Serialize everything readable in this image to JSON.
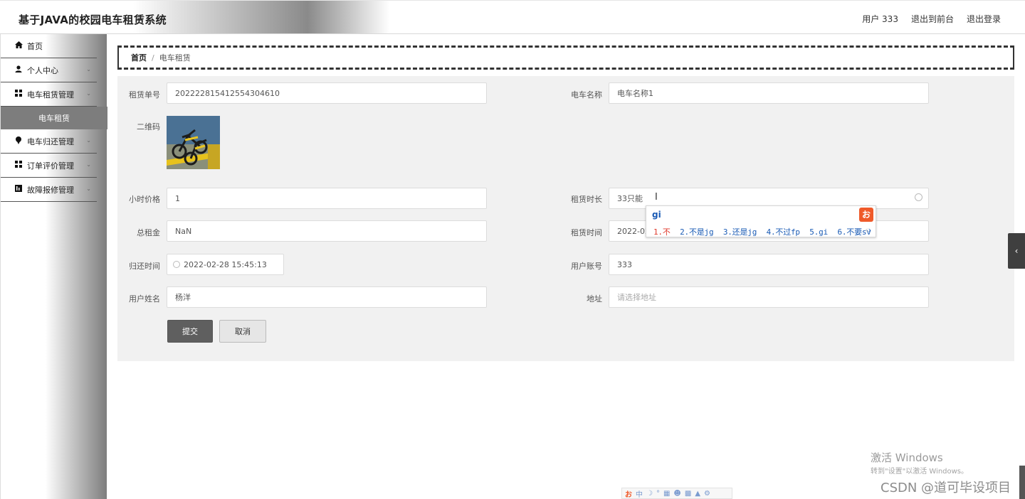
{
  "header": {
    "title": "基于JAVA的校园电车租赁系统",
    "user_label": "用户 333",
    "to_front_label": "退出到前台",
    "logout_label": "退出登录"
  },
  "sidebar": {
    "items": [
      {
        "label": "首页",
        "icon": "home-icon"
      },
      {
        "label": "个人中心",
        "icon": "user-icon"
      },
      {
        "label": "电车租赁管理",
        "icon": "grid-icon"
      },
      {
        "label": "电车租赁",
        "icon": ""
      },
      {
        "label": "电车归还管理",
        "icon": "pin-icon"
      },
      {
        "label": "订单评价管理",
        "icon": "grid-icon"
      },
      {
        "label": "故障报修管理",
        "icon": "chart-icon"
      }
    ]
  },
  "breadcrumb": {
    "home": "首页",
    "separator": "/",
    "current": "电车租赁"
  },
  "form": {
    "order_no": {
      "label": "租赁单号",
      "value": "202222815412554304610"
    },
    "car_name": {
      "label": "电车名称",
      "value": "电车名称1"
    },
    "qr_code": {
      "label": "二维码"
    },
    "hourly_price": {
      "label": "小时价格",
      "value": "1"
    },
    "duration": {
      "label": "租赁时长",
      "value": "33只能"
    },
    "total_rent": {
      "label": "总租金",
      "value": "NaN"
    },
    "rent_time": {
      "label": "租赁时间",
      "value": "2022-02-"
    },
    "return_time": {
      "label": "归还时间",
      "value": "2022-02-28 15:45:13"
    },
    "user_account": {
      "label": "用户账号",
      "value": "333"
    },
    "user_name": {
      "label": "用户姓名",
      "value": "杨洋"
    },
    "address": {
      "label": "地址",
      "placeholder": "请选择地址"
    },
    "submit_label": "提交",
    "cancel_label": "取消"
  },
  "ime": {
    "composition": "gi",
    "candidates": [
      "1.不",
      "2.不是jg",
      "3.还是jg",
      "4.不过fp",
      "5.gi",
      "6.不要sv"
    ]
  },
  "watermark": {
    "activate_title": "激活 Windows",
    "activate_sub": "转到\"设置\"以激活 Windows。",
    "csdn": "CSDN @道可毕设项目"
  },
  "ime_toolbar": {
    "lang": "中"
  },
  "colors": {
    "accent": "#5f5f5f",
    "ime_orange": "#ef5a2a",
    "ime_blue": "#1a5bb5"
  }
}
